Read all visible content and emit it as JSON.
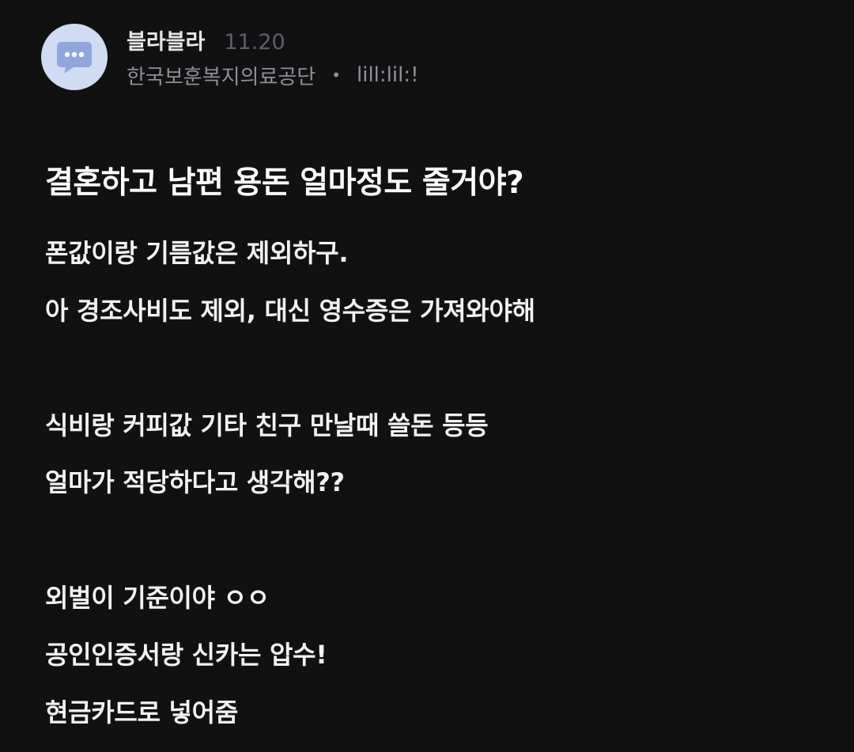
{
  "post": {
    "author": "블라블라",
    "date": "11.20",
    "company": "한국보훈복지의료공단",
    "separator": "•",
    "job_label": "lill:lil:!",
    "title": "결혼하고 남편 용돈 얼마정도 줄거야?",
    "body": [
      "폰값이랑 기름값은 제외하구.",
      "아 경조사비도 제외, 대신 영수증은 가져와야해",
      "",
      "식비랑 커피값 기타 친구 만날때 쓸돈 등등",
      "얼마가 적당하다고 생각해??",
      "",
      "외벌이 기준이야 ㅇㅇ",
      "공인인증서랑 신카는 압수!",
      "현금카드로 넣어줌"
    ]
  },
  "icons": {
    "avatar": "speech-bubble-icon"
  },
  "colors": {
    "background": "#111112",
    "avatar_bg": "#cfdcf2",
    "bubble": "#8fa7dc",
    "text": "#ffffff",
    "muted": "#8f8f94",
    "date": "#5f5f63"
  }
}
